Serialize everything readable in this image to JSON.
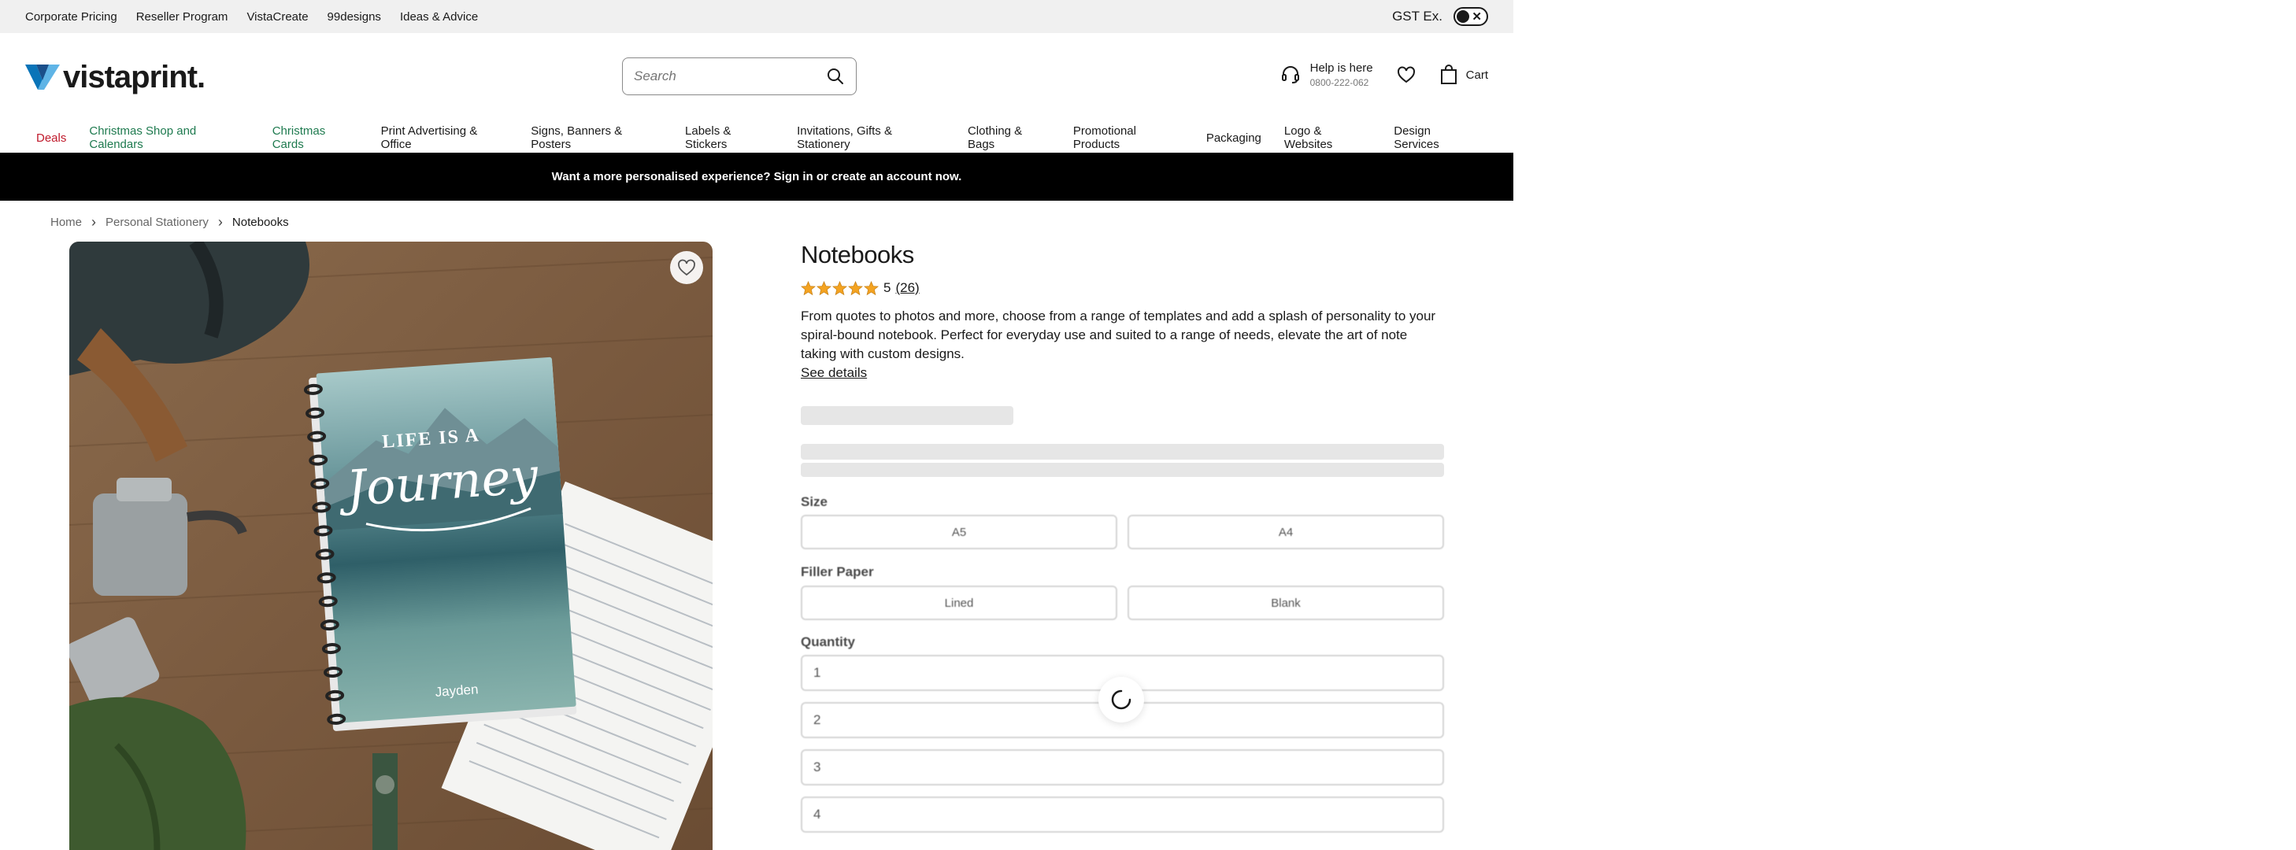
{
  "utility_bar": {
    "links": [
      "Corporate Pricing",
      "Reseller Program",
      "VistaCreate",
      "99designs",
      "Ideas & Advice"
    ],
    "gst_label": "GST Ex."
  },
  "header": {
    "logo_text": "vistaprint.",
    "search_placeholder": "Search",
    "help_title": "Help is here",
    "help_phone": "0800-222-062",
    "cart_label": "Cart"
  },
  "nav": {
    "items": [
      {
        "label": "Deals",
        "color": "#c0192b"
      },
      {
        "label": "Christmas Shop and Calendars",
        "color": "#1e7a4f"
      },
      {
        "label": "Christmas Cards",
        "color": "#1e7a4f"
      },
      {
        "label": "Print Advertising & Office"
      },
      {
        "label": "Signs, Banners & Posters"
      },
      {
        "label": "Labels & Stickers"
      },
      {
        "label": "Invitations, Gifts & Stationery"
      },
      {
        "label": "Clothing & Bags"
      },
      {
        "label": "Promotional Products"
      },
      {
        "label": "Packaging"
      },
      {
        "label": "Logo & Websites"
      },
      {
        "label": "Design Services"
      }
    ]
  },
  "promo": {
    "text": "Want a more personalised experience? Sign in or create an account now."
  },
  "breadcrumb": {
    "items": [
      "Home",
      "Personal Stationery",
      "Notebooks"
    ]
  },
  "product": {
    "title": "Notebooks",
    "rating_value": "5",
    "rating_count": "(26)",
    "stars": 5,
    "description": "From quotes to photos and more, choose from a range of templates and add a splash of personality to your spiral-bound notebook. Perfect for everyday use and suited to a range of needs, elevate the art of note taking with custom designs.",
    "see_details": "See details",
    "image_text": {
      "cover_line1": "LIFE IS A",
      "cover_line2": "Journey",
      "cover_name": "Jayden"
    }
  },
  "options": {
    "size_label": "Size",
    "size_options": [
      "A5",
      "A4"
    ],
    "filler_label": "Filler Paper",
    "filler_options": [
      "Lined",
      "Blank"
    ],
    "quantity_label": "Quantity",
    "quantity_options": [
      "1",
      "2",
      "3",
      "4"
    ]
  },
  "colors": {
    "brand_blue": "#0a74b8",
    "deal_red": "#c0192b",
    "seasonal_green": "#1e7a4f",
    "star_gold": "#f4a321"
  }
}
